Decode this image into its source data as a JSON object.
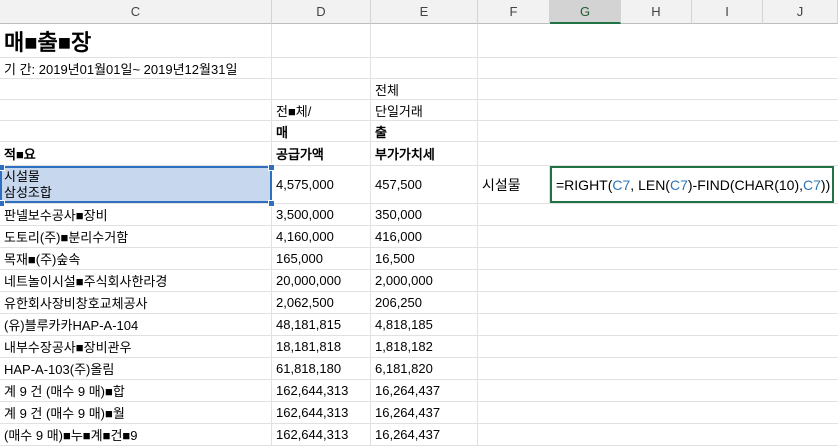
{
  "columns": [
    "C",
    "D",
    "E",
    "F",
    "G",
    "H",
    "I",
    "J"
  ],
  "title": "매■출■장",
  "period": "기 간: 2019년01월01일~ 2019년12월31일",
  "header": {
    "e3": "전체",
    "d4": "전■체/",
    "e4": "단일거래",
    "d5": "매",
    "e5": "출",
    "c6": "적■요",
    "d6": "공급가액",
    "e6": "부가가치세"
  },
  "selected_cell": {
    "line1": "시설물",
    "line2": "삼성조합",
    "amount": "4,575,000",
    "tax": "457,500"
  },
  "f7_value": "시설물",
  "formula": {
    "p1": "=RIGHT(",
    "r1": "C7",
    "p2": ", LEN(",
    "r2": "C7",
    "p3": ")-FIND(CHAR(10),",
    "r3": "C7",
    "p4": "))"
  },
  "rows": [
    {
      "desc": "판넬보수공사■장비",
      "amount": "3,500,000",
      "tax": "350,000"
    },
    {
      "desc": "도토리(주)■분리수거함",
      "amount": "4,160,000",
      "tax": "416,000"
    },
    {
      "desc": "목재■(주)숲속",
      "amount": "165,000",
      "tax": "16,500"
    },
    {
      "desc": "네트놀이시설■주식회사한라경",
      "amount": "20,000,000",
      "tax": "2,000,000"
    },
    {
      "desc": "유한회사장비창호교체공사",
      "amount": "2,062,500",
      "tax": "206,250"
    },
    {
      "desc": "(유)블루카카HAP-A-104",
      "amount": "48,181,815",
      "tax": "4,818,185"
    },
    {
      "desc": "내부수장공사■장비관우",
      "amount": "18,181,818",
      "tax": "1,818,182"
    },
    {
      "desc": "HAP-A-103(주)올림",
      "amount": "61,818,180",
      "tax": "6,181,820"
    },
    {
      "desc": "계 9 건 (매수 9 매)■합",
      "amount": "162,644,313",
      "tax": "16,264,437"
    },
    {
      "desc": "계 9 건 (매수 9 매)■월",
      "amount": "162,644,313",
      "tax": "16,264,437"
    },
    {
      "desc": "(매수 9 매)■누■계■건■9",
      "amount": "162,644,313",
      "tax": "16,264,437"
    }
  ]
}
